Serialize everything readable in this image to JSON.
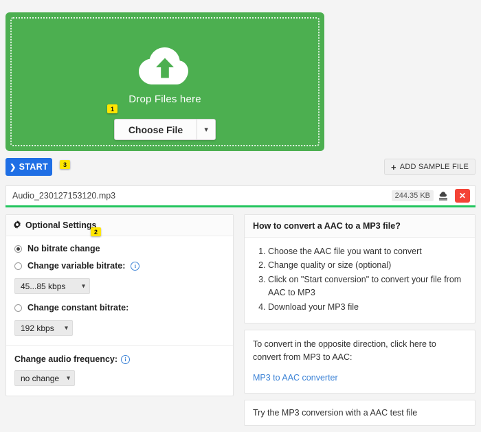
{
  "colors": {
    "dropzone_green": "#4caf50",
    "start_blue": "#1f6fe5",
    "progress_green": "#21c55d",
    "remove_red": "#f44336",
    "badge_yellow": "#ffe600",
    "link_blue": "#3b82d6",
    "page_bg": "#f4f4f4"
  },
  "dropzone": {
    "icon": "cloud-upload-icon",
    "drop_text": "Drop Files here",
    "choose_file_label": "Choose File",
    "caret_icon": "chevron-down-icon"
  },
  "badges": {
    "one": "1",
    "two": "2",
    "three": "3"
  },
  "actions": {
    "start_label": "START",
    "start_icon": "chevron-right-icon",
    "add_sample_label": "ADD SAMPLE FILE",
    "add_sample_icon": "plus-icon"
  },
  "file": {
    "name": "Audio_230127153120.mp3",
    "size": "244.35 KB",
    "download_icon": "cloud-download-icon",
    "remove_icon": "close-icon",
    "remove_label": "✕"
  },
  "settings": {
    "title": "Optional Settings",
    "gear_icon": "gear-icon",
    "options": [
      {
        "label": "No bitrate change",
        "selected": true,
        "has_info": false
      },
      {
        "label": "Change variable bitrate:",
        "selected": false,
        "has_info": true
      },
      {
        "label": "Change constant bitrate:",
        "selected": false,
        "has_info": false
      }
    ],
    "variable_bitrate_value": "45...85 kbps",
    "constant_bitrate_value": "192 kbps",
    "frequency_label": "Change audio frequency:",
    "frequency_value": "no change",
    "info_icon": "info-circle-icon",
    "caret_icon": "chevron-down-icon"
  },
  "info": {
    "howto_title": "How to convert a AAC to a MP3 file?",
    "howto_steps": [
      "Choose the AAC file you want to convert",
      "Change quality or size (optional)",
      "Click on \"Start conversion\" to convert your file from AAC to MP3",
      "Download your MP3 file"
    ],
    "opposite_text": "To convert in the opposite direction, click here to convert from MP3 to AAC:",
    "opposite_link": "MP3 to AAC converter",
    "test_file_text": "Try the MP3 conversion with a AAC test file"
  }
}
